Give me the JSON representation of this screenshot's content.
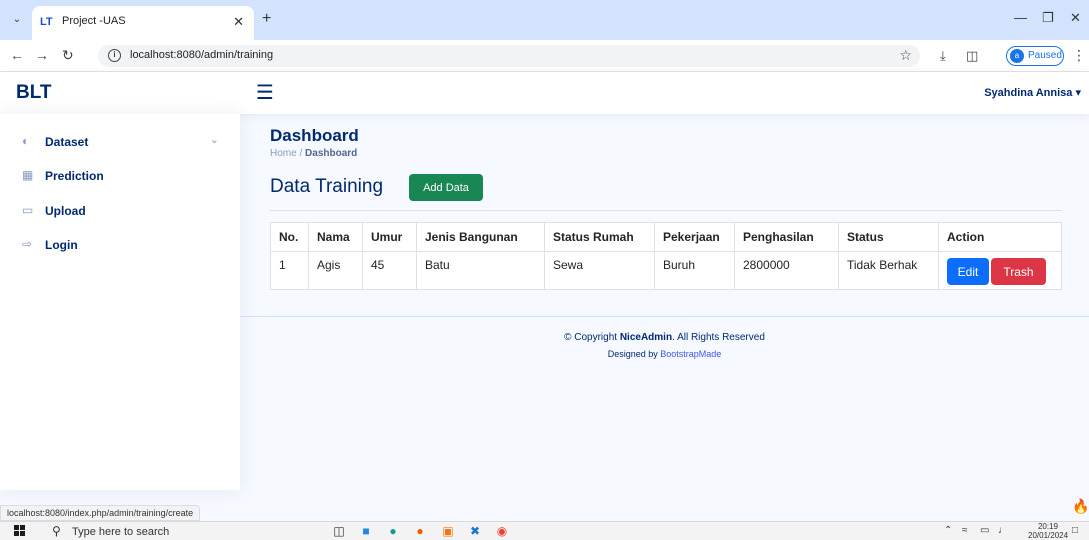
{
  "browser": {
    "tab_favicon": "LT",
    "tab_title": "Project -UAS",
    "url": "localhost:8080/admin/training",
    "profile_initial": "a",
    "profile_status": "Paused",
    "hover_url": "localhost:8080/index.php/admin/training/create"
  },
  "header": {
    "brand": "BLT",
    "user_name": "Syahdina Annisa ▾"
  },
  "sidebar": {
    "items": [
      {
        "label": "Dataset",
        "icon": "database-icon"
      },
      {
        "label": "Prediction",
        "icon": "calculator-icon"
      },
      {
        "label": "Upload",
        "icon": "upload-icon"
      },
      {
        "label": "Login",
        "icon": "login-icon"
      }
    ]
  },
  "main": {
    "page_title": "Dashboard",
    "breadcrumb": {
      "home": "Home",
      "separator": "/",
      "current": "Dashboard"
    },
    "section_title": "Data Training",
    "add_button": "Add Data"
  },
  "table": {
    "headers": [
      "No.",
      "Nama",
      "Umur",
      "Jenis Bangunan",
      "Status Rumah",
      "Pekerjaan",
      "Penghasilan",
      "Status",
      "Action"
    ],
    "rows": [
      {
        "no": "1",
        "nama": "Agis",
        "umur": "45",
        "jenis_bangunan": "Batu",
        "status_rumah": "Sewa",
        "pekerjaan": "Buruh",
        "penghasilan": "2800000",
        "status": "Tidak Berhak",
        "edit": "Edit",
        "trash": "Trash"
      }
    ]
  },
  "footer": {
    "copyright_prefix": "© Copyright ",
    "copyright_brand": "NiceAdmin",
    "copyright_suffix": ". All Rights Reserved",
    "designed_prefix": "Designed by ",
    "designed_link": "BootstrapMade"
  },
  "taskbar": {
    "search_placeholder": "Type here to search",
    "time": "20:19",
    "date": "20/01/2024"
  },
  "colors": {
    "primary": "#012970",
    "success": "#198754",
    "edit": "#0d6efd",
    "danger": "#dc3545"
  }
}
